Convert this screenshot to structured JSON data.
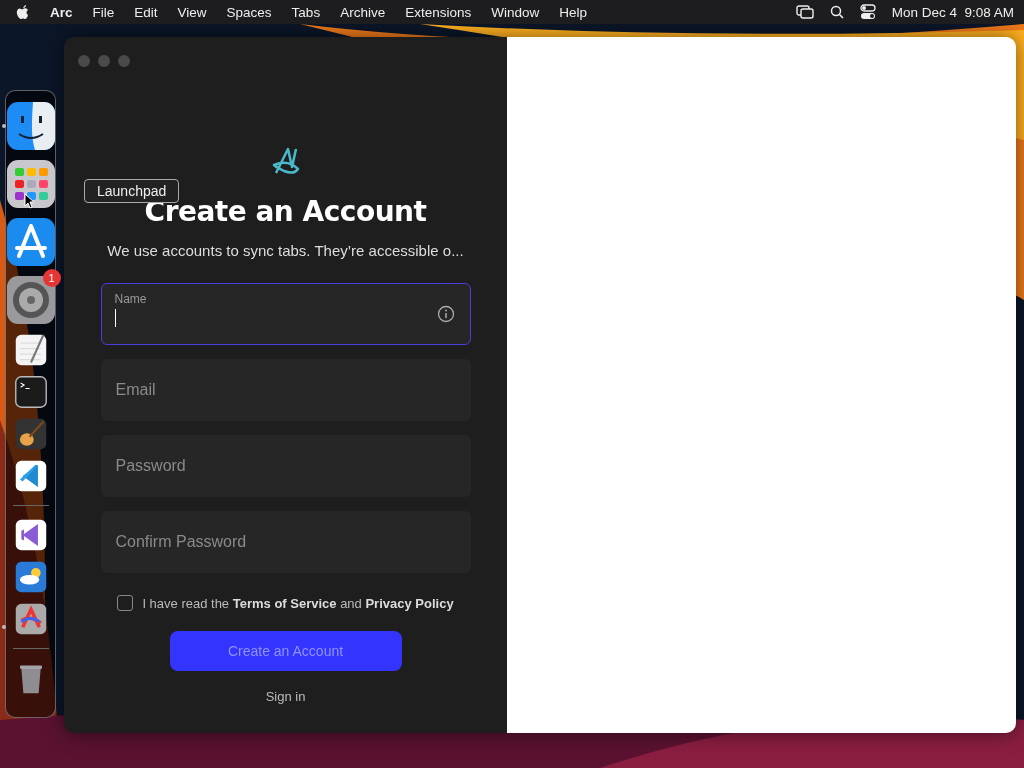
{
  "menu_bar": {
    "app_name": "Arc",
    "items": [
      "File",
      "Edit",
      "View",
      "Spaces",
      "Tabs",
      "Archive",
      "Extensions",
      "Window",
      "Help"
    ],
    "clock": "Mon Dec 4  9:08 AM"
  },
  "dock": {
    "items": [
      {
        "kind": "finder",
        "running": true
      },
      {
        "kind": "launchpad",
        "running": false
      },
      {
        "kind": "appstore",
        "running": false
      },
      {
        "kind": "settings",
        "running": false,
        "badge": "1"
      },
      {
        "kind": "textedit",
        "running": false
      },
      {
        "kind": "terminal",
        "running": false
      },
      {
        "kind": "guitar",
        "running": false
      },
      {
        "kind": "vscode",
        "running": false
      },
      {
        "kind": "divider"
      },
      {
        "kind": "visualstudio",
        "running": false
      },
      {
        "kind": "weather",
        "running": false
      },
      {
        "kind": "arc",
        "running": true
      },
      {
        "kind": "divider"
      },
      {
        "kind": "trash",
        "running": false
      }
    ]
  },
  "tooltip": {
    "label": "Launchpad"
  },
  "form": {
    "title": "Create an Account",
    "subtitle": "We use accounts to sync tabs. They’re accessible o...",
    "fields": [
      {
        "label": "Name",
        "focused": true
      },
      {
        "placeholder": "Email",
        "focused": false
      },
      {
        "placeholder": "Password",
        "focused": false
      },
      {
        "placeholder": "Confirm Password",
        "focused": false
      }
    ],
    "terms": {
      "checked": false,
      "text": "I have read the **Terms of Service** and **Privacy Policy**"
    },
    "submit": "Create an Account",
    "sign_in": "Sign in"
  }
}
